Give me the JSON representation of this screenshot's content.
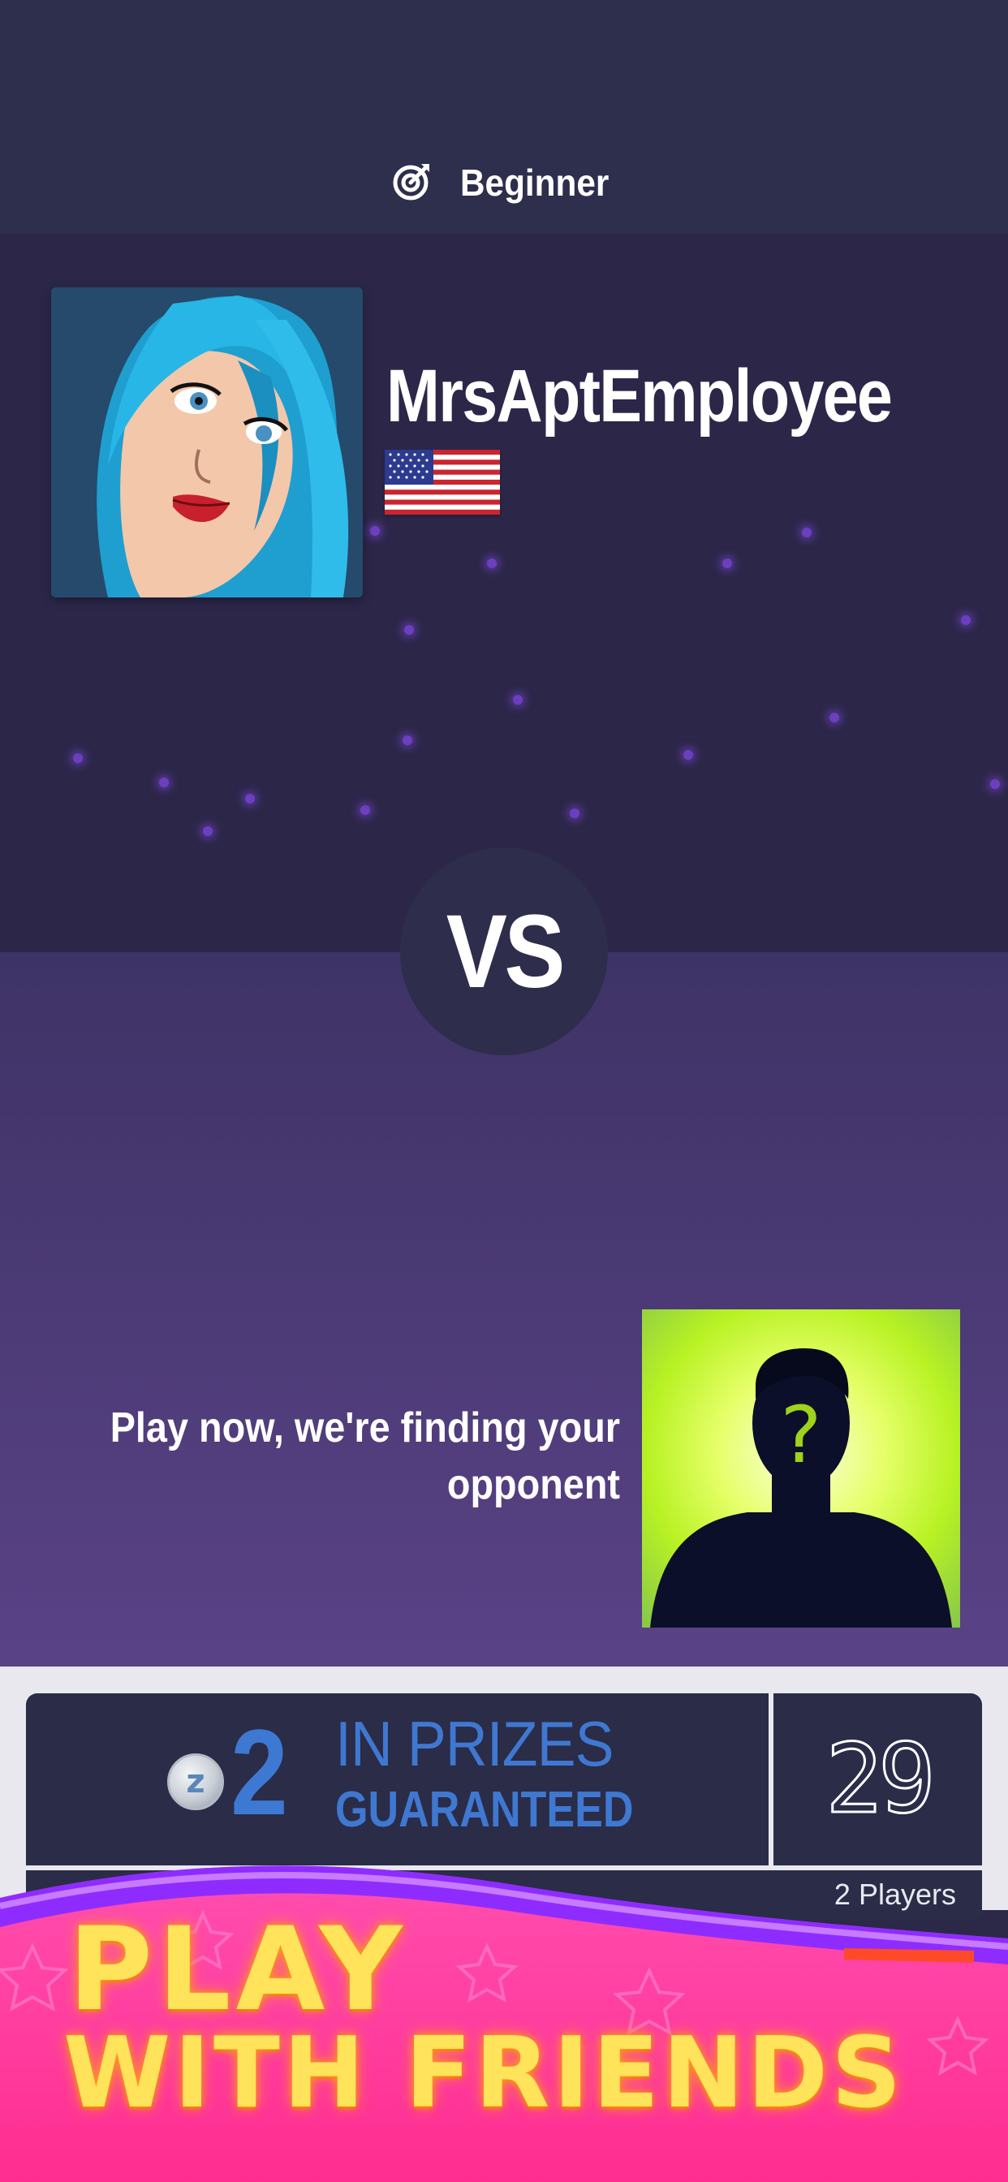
{
  "header": {
    "level_icon": "target-icon",
    "level_label": "Beginner"
  },
  "player": {
    "name": "MrsAptEmployee",
    "flag": "us-flag-icon"
  },
  "versus": {
    "label": "VS"
  },
  "opponent": {
    "status_text": "Play now, we're finding your opponent",
    "avatar_mark": "?"
  },
  "prize": {
    "coin_letter": "z",
    "amount": "2",
    "line1": "IN PRIZES",
    "line2": "GUARANTEED",
    "timer": "29",
    "players": "2 Players"
  },
  "banner": {
    "line1": "PLAY",
    "line2": "WITH FRIENDS"
  },
  "colors": {
    "accent_blue": "#3d79d3",
    "banner_text": "#ffe35a",
    "banner_bg": "#ff3aa6",
    "banner_wave": "#9a2cff"
  }
}
